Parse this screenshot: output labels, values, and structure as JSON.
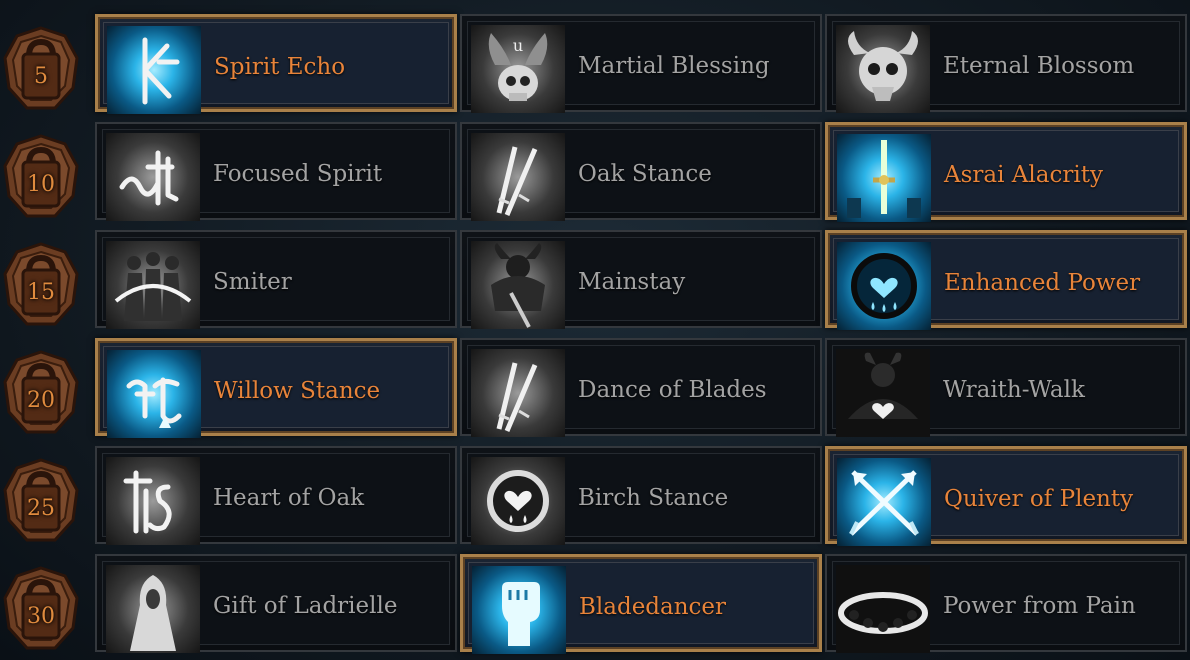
{
  "rows": [
    {
      "level": "5",
      "skills": [
        {
          "name": "Spirit Echo",
          "icon": "spirit-echo-rune-icon",
          "selected": true
        },
        {
          "name": "Martial Blessing",
          "icon": "winged-skull-icon",
          "selected": false
        },
        {
          "name": "Eternal Blossom",
          "icon": "horned-skull-icon",
          "selected": false
        }
      ]
    },
    {
      "level": "10",
      "skills": [
        {
          "name": "Focused Spirit",
          "icon": "focused-spirit-rune-icon",
          "selected": false
        },
        {
          "name": "Oak Stance",
          "icon": "crossed-daggers-icon",
          "selected": false
        },
        {
          "name": "Asrai Alacrity",
          "icon": "glowing-sword-icon",
          "selected": true
        }
      ]
    },
    {
      "level": "15",
      "skills": [
        {
          "name": "Smiter",
          "icon": "marching-figures-icon",
          "selected": false
        },
        {
          "name": "Mainstay",
          "icon": "horned-warrior-icon",
          "selected": false
        },
        {
          "name": "Enhanced Power",
          "icon": "heart-drops-icon",
          "selected": true
        }
      ]
    },
    {
      "level": "20",
      "skills": [
        {
          "name": "Willow Stance",
          "icon": "willow-rune-icon",
          "selected": true
        },
        {
          "name": "Dance of Blades",
          "icon": "crossed-daggers-icon",
          "selected": false
        },
        {
          "name": "Wraith-Walk",
          "icon": "horned-demon-icon",
          "selected": false
        }
      ]
    },
    {
      "level": "25",
      "skills": [
        {
          "name": "Heart of Oak",
          "icon": "oak-rune-icon",
          "selected": false
        },
        {
          "name": "Birch Stance",
          "icon": "heart-ring-icon",
          "selected": false
        },
        {
          "name": "Quiver of Plenty",
          "icon": "crossed-arrows-icon",
          "selected": true
        }
      ]
    },
    {
      "level": "30",
      "skills": [
        {
          "name": "Gift of Ladrielle",
          "icon": "hooded-figure-icon",
          "selected": false
        },
        {
          "name": "Bladedancer",
          "icon": "raised-fist-icon",
          "selected": true
        },
        {
          "name": "Power from Pain",
          "icon": "skull-ring-icon",
          "selected": false
        }
      ]
    }
  ],
  "colors": {
    "selected_text": "#e8843a",
    "unselected_text": "#a3a3a3",
    "selected_border": "#a9804a",
    "level_number": "#e08b3e"
  }
}
